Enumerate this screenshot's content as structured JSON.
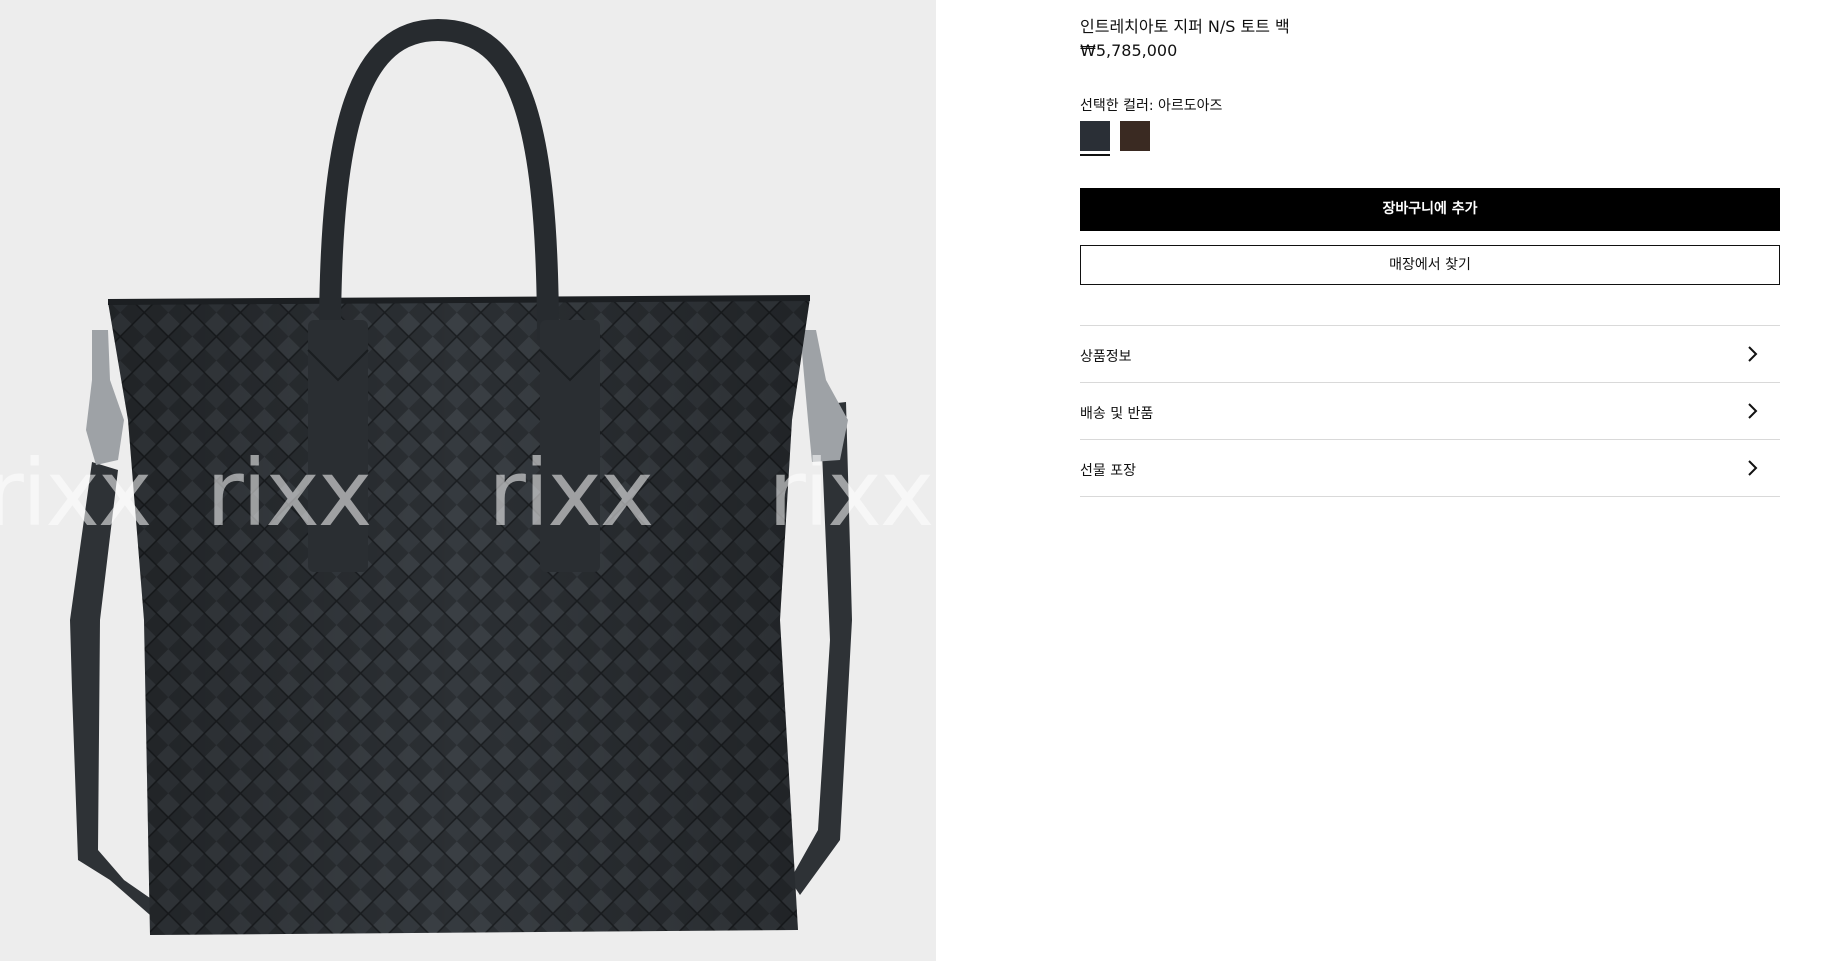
{
  "gallery": {
    "watermark_text": "rixx",
    "image_alt": "bag-photo"
  },
  "product": {
    "title": "인트레치아토 지퍼 N/S 토트 백",
    "price": "₩5,785,000",
    "color_label": "선택한 컬러: 아르도아즈",
    "swatches": [
      {
        "name": "ardoise",
        "color": "#2a2f36",
        "selected": true
      },
      {
        "name": "brown",
        "color": "#3a2a22",
        "selected": false
      }
    ]
  },
  "actions": {
    "add_to_cart": "장바구니에 추가",
    "find_in_store": "매장에서 찾기"
  },
  "accordion": {
    "items": [
      {
        "label": "상품정보",
        "icon": "chevron-right-icon"
      },
      {
        "label": "배송 및 반품",
        "icon": "chevron-right-icon"
      },
      {
        "label": "선물 포장",
        "icon": "chevron-right-icon"
      }
    ]
  },
  "colors": {
    "accent": "#000000",
    "divider": "#d9d9d9",
    "gallery_bg": "#ededed"
  }
}
